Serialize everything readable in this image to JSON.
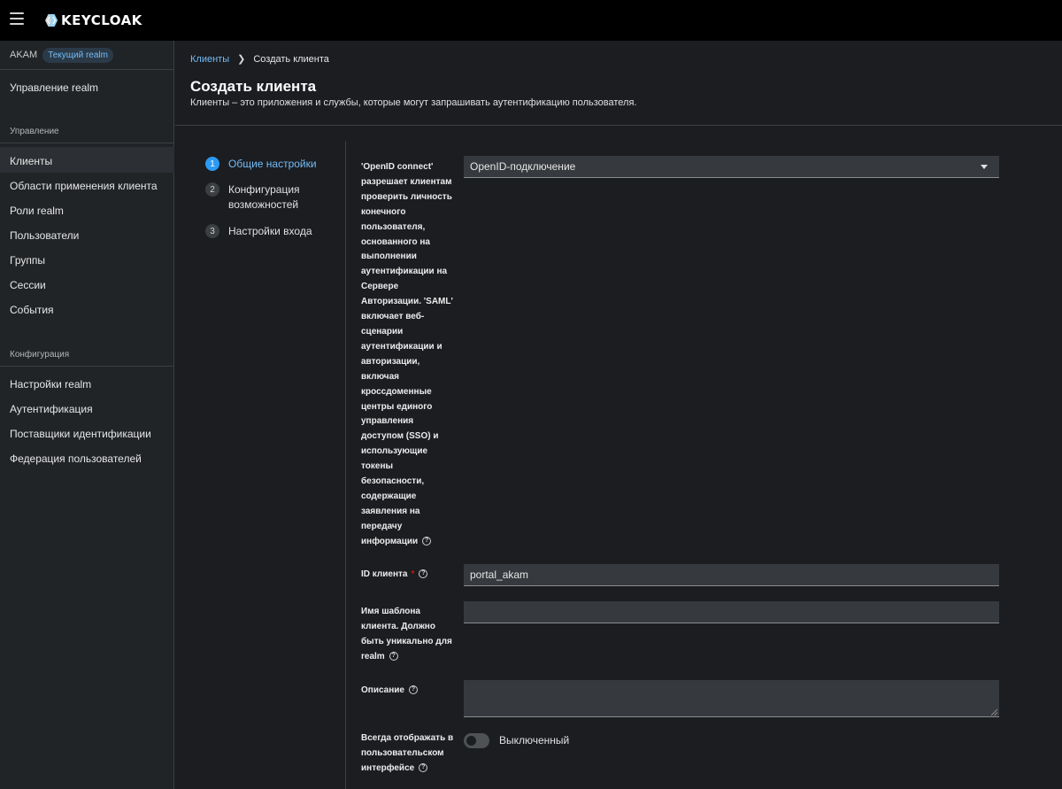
{
  "header": {
    "logo_text": "KEYCLOAK"
  },
  "sidebar": {
    "realm_name": "AKAM",
    "realm_badge": "Текущий realm",
    "realm_settings_link": "Управление realm",
    "section_manage": "Управление",
    "manage_items": [
      "Клиенты",
      "Области применения клиента",
      "Роли realm",
      "Пользователи",
      "Группы",
      "Сессии",
      "События"
    ],
    "section_configure": "Конфигурация",
    "configure_items": [
      "Настройки realm",
      "Аутентификация",
      "Поставщики идентификации",
      "Федерация пользователей"
    ],
    "active_item": "Клиенты"
  },
  "breadcrumb": {
    "parent": "Клиенты",
    "current": "Создать клиента"
  },
  "page": {
    "title": "Создать клиента",
    "description": "Клиенты – это приложения и службы, которые могут запрашивать аутентификацию пользователя."
  },
  "wizard": {
    "steps": [
      {
        "number": "1",
        "label": "Общие настройки",
        "active": true
      },
      {
        "number": "2",
        "label": "Конфигурация возможностей",
        "active": false
      },
      {
        "number": "3",
        "label": "Настройки входа",
        "active": false
      }
    ]
  },
  "form": {
    "client_type_label": "'OpenID connect' разрешает клиентам проверить личность конечного пользователя, основанного на выполнении аутентификации на Сервере Авторизации. 'SAML' включает веб-сценарии аутентификации и авторизации, включая кроссдоменные центры единого управления доступом (SSO) и использующие токены безопасности, содержащие заявления на передачу информации",
    "client_type_value": "OpenID-подключение",
    "client_id_label": "ID клиента",
    "client_id_required": "*",
    "client_id_value": "portal_akam",
    "name_label": "Имя шаблона клиента. Должно быть уникально для realm",
    "name_value": "",
    "description_label": "Описание",
    "description_value": "",
    "always_display_label": "Всегда отображать в пользовательском интерфейсе",
    "always_display_state": "Выключенный",
    "always_display_on": false
  },
  "colors": {
    "accent": "#73bcf7",
    "step_active": "#2b9af3",
    "required": "#c9190b",
    "background": "#1b1d21",
    "sidebar": "#212427",
    "masthead": "#000000"
  }
}
